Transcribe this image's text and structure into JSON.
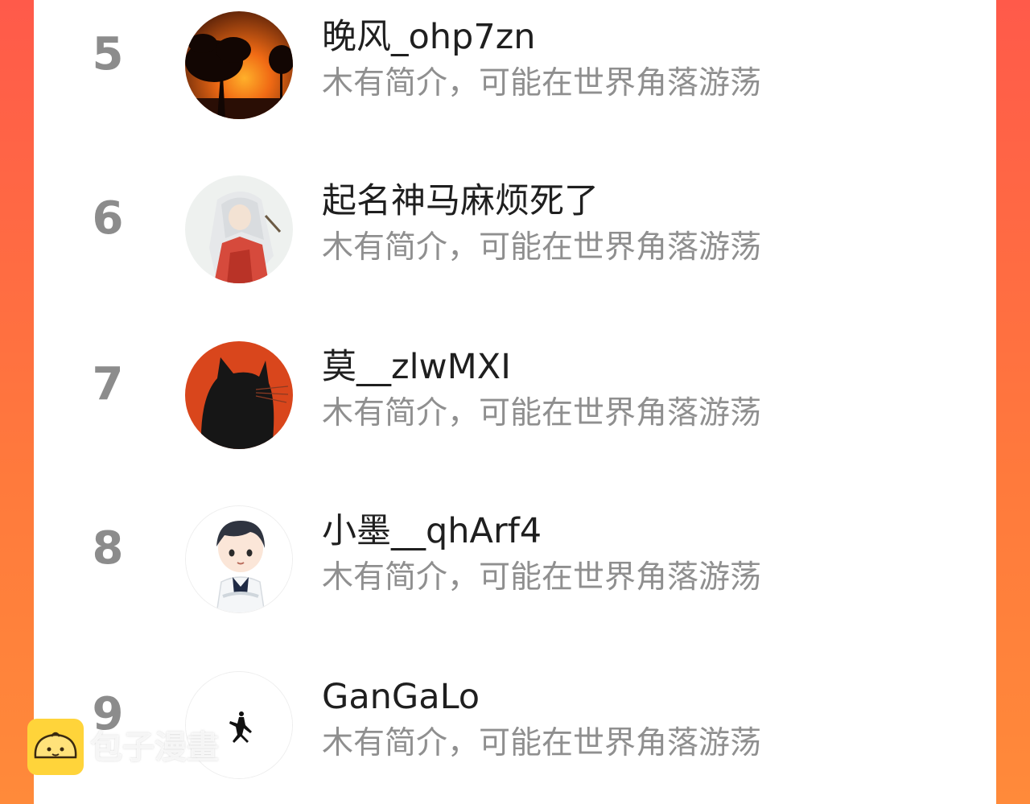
{
  "theme": {
    "background_accent": "#ff5a4a",
    "panel_color": "#ffffff",
    "rank_color": "#8c8c8c",
    "name_color": "#1f1f1f",
    "bio_color": "#8f8f8f",
    "watermark_logo_color": "#ffd43a"
  },
  "ranking_list": [
    {
      "rank": "5",
      "name": "晚风_ohp7zn",
      "bio": "木有简介，可能在世界角落游荡",
      "avatar_icon": "sunset-tree-avatar"
    },
    {
      "rank": "6",
      "name": "起名神马麻烦死了",
      "bio": "木有简介，可能在世界角落游荡",
      "avatar_icon": "anime-character-avatar"
    },
    {
      "rank": "7",
      "name": "莫__zlwMXI",
      "bio": "木有简介，可能在世界角落游荡",
      "avatar_icon": "black-cat-avatar"
    },
    {
      "rank": "8",
      "name": "小墨__qhArf4",
      "bio": "木有简介，可能在世界角落游荡",
      "avatar_icon": "cartoon-boy-avatar"
    },
    {
      "rank": "9",
      "name": "GanGaLo",
      "bio": "木有简介，可能在世界角落游荡",
      "avatar_icon": "jumpman-logo-avatar"
    }
  ],
  "watermark": {
    "text": "包子漫畫",
    "logo_icon": "bun-logo-icon"
  }
}
